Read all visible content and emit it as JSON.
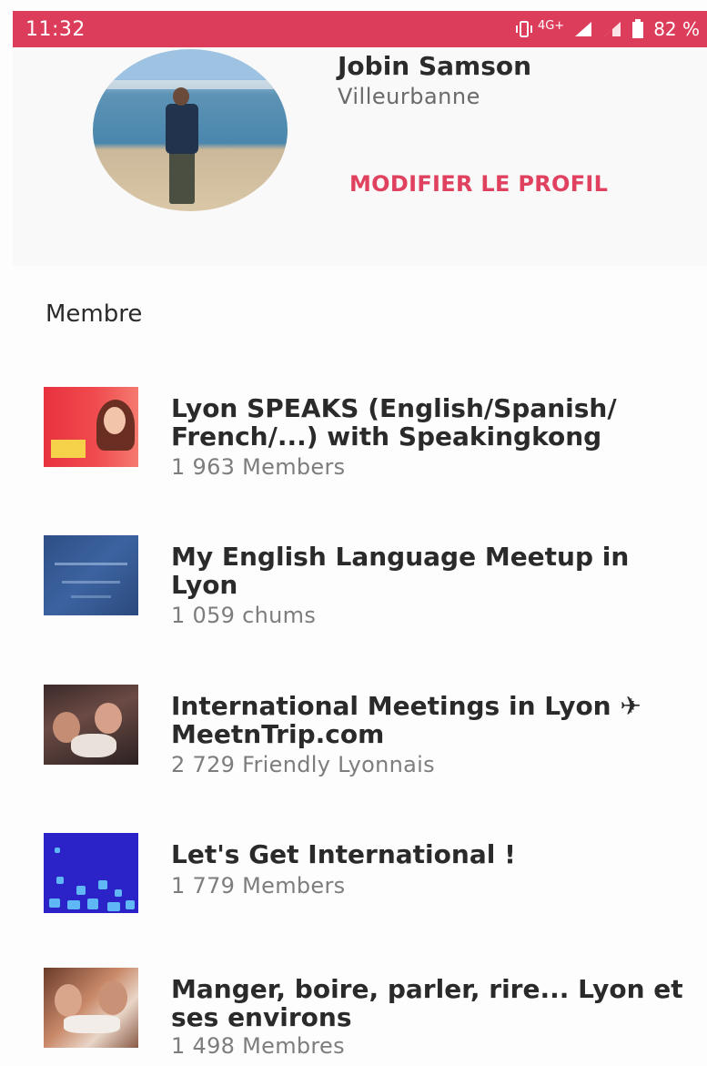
{
  "status_bar": {
    "time": "11:32",
    "network": "4G+",
    "battery": "82 %",
    "background_color": "#dc3d5a"
  },
  "profile": {
    "name": "Jobin Samson",
    "city": "Villeurbanne",
    "edit_label": "MODIFIER LE PROFIL",
    "accent_color": "#e0415f"
  },
  "section": {
    "title": "Membre"
  },
  "groups": [
    {
      "name": "Lyon SPEAKS (English/Spanish/ French/...) with Speakingkong",
      "count": "1 963 Members"
    },
    {
      "name": "My English Language Meetup in Lyon",
      "count": "1 059 chums"
    },
    {
      "name": "International Meetings in Lyon ✈ MeetnTrip.com",
      "count": "2 729 Friendly Lyonnais"
    },
    {
      "name": "Let's Get International !",
      "count": "1 779 Members"
    },
    {
      "name": "Manger, boire, parler, rire... Lyon et ses environs",
      "count": "1 498 Membres"
    }
  ]
}
